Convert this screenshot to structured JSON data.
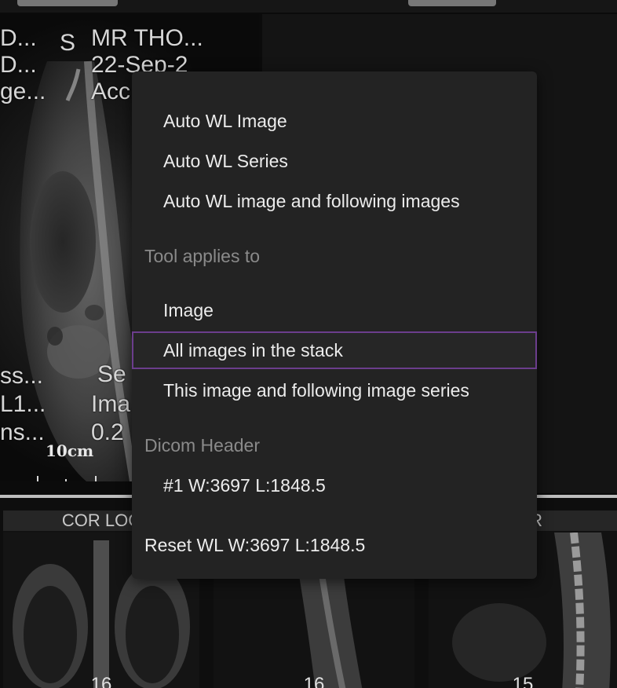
{
  "viewer": {
    "main_overlay": {
      "top_left": [
        "D...",
        "D...",
        "ge..."
      ],
      "orientation_top": "S",
      "top_right": [
        "MR THO...",
        "22-Sep-2",
        "Acc"
      ],
      "bottom_left": [
        "ss...",
        "L1...",
        "ns..."
      ],
      "bottom_right": [
        "Se",
        "Ima",
        "0.2"
      ],
      "scale": "10cm"
    },
    "thumbnails": [
      {
        "title": "COR LOC",
        "count": "16"
      },
      {
        "title": "",
        "count": "16"
      },
      {
        "title": "STIR",
        "count": "15"
      }
    ]
  },
  "context_menu": {
    "items_auto_wl": [
      "Auto WL Image",
      "Auto WL Series",
      "Auto WL image and following images"
    ],
    "section_tool_applies": "Tool applies to",
    "items_tool_applies": [
      "Image",
      "All images in the stack",
      "This image and following image series"
    ],
    "selected_item": "All images in the stack",
    "section_dicom": "Dicom Header",
    "dicom_item": "#1 W:3697 L:1848.5",
    "reset_item": "Reset WL W:3697 L:1848.5"
  },
  "colors": {
    "menu_background": "#232323",
    "selected_border": "#6b3d8c",
    "header_text": "#8a8a8a",
    "item_text": "#ececec"
  }
}
